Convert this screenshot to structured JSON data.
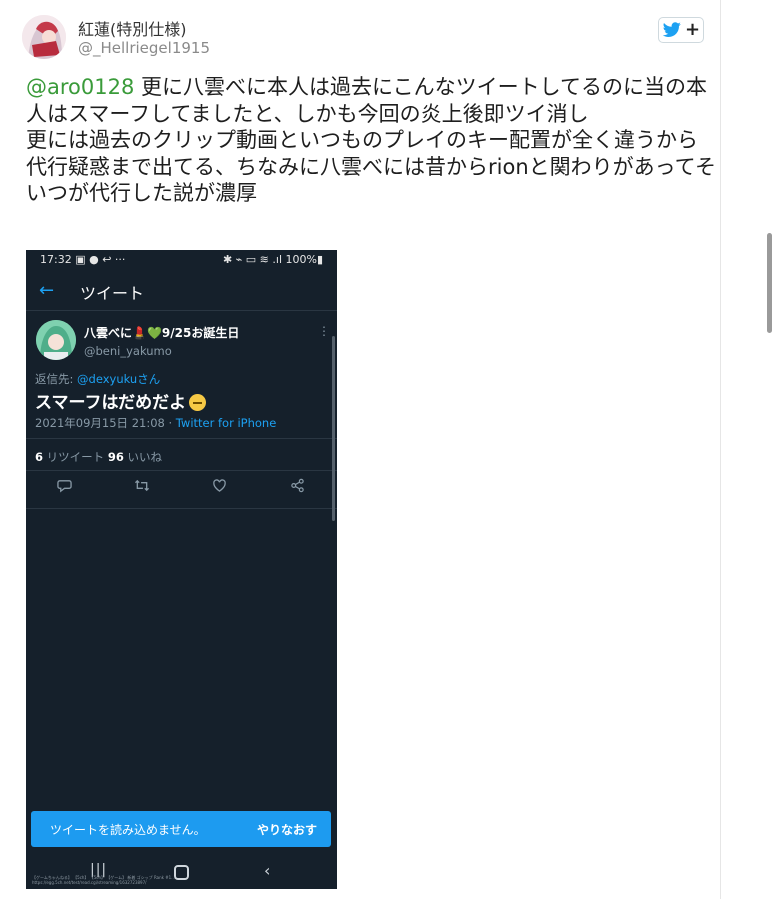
{
  "author": {
    "name": "紅蓮(特別仕様)",
    "handle": "@_Hellriegel1915"
  },
  "follow_button": {
    "icon": "twitter-bird-icon",
    "plus": "+"
  },
  "tweet": {
    "mention": "@aro0128",
    "body": " 更に八雲べに本人は過去にこんなツイートしてるのに当の本人はスマーフしてましたと、しかも今回の炎上後即ツイ消し\n更には過去のクリップ動画といつものプレイのキー配置が全く違うから代行疑惑まで出てる、ちなみに八雲べには昔からrionと関わりがあってそいつが代行した説が濃厚"
  },
  "screenshot": {
    "status_time": "17:32",
    "status_icons": "▣ ● ↩ ···",
    "status_right": "✱ ⌁ ▭ ≋ .ıl 100%▮",
    "header_title": "ツイート",
    "name": "八雲べに💄💚9/25お誕生日",
    "handle": "@beni_yakumo",
    "reply_prefix": "返信先: ",
    "reply_to": "@dexyukuさん",
    "main_text": "スマーフはだめだよ",
    "timestamp": "2021年09月15日 21:08 · ",
    "via": "Twitter for iPhone",
    "retweet_count": "6",
    "retweet_label": " リツイート  ",
    "like_count": "96",
    "like_label": " いいね",
    "snackbar_text": "ツイートを読み込めません。",
    "snackbar_action": "やりなおす",
    "watermark": "【ゲームちゃんねる】 【5ch】 【5ch】 【ゲーム】 新着 ゴシップ Rank #1…  https://egg.5ch.net/test/read.cgi/streaming/1632723897/"
  },
  "colors": {
    "mention": "#3a9b3a",
    "twitter_blue": "#1da1f2",
    "dark_bg": "#15202b"
  }
}
